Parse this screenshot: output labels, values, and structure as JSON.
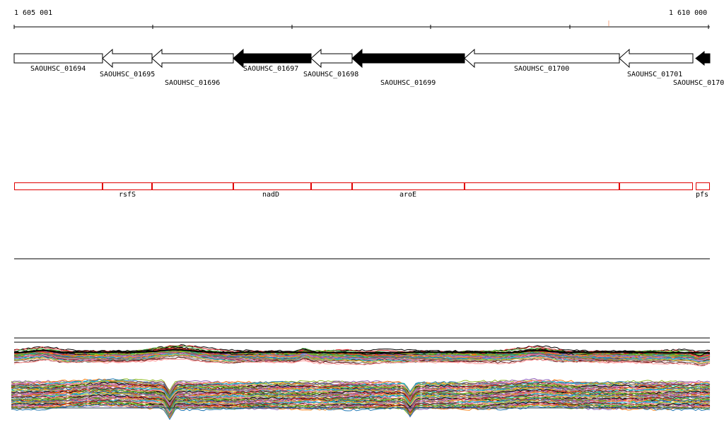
{
  "coordinates": {
    "start_label": "1 605 001",
    "end_label": "1 610 000"
  },
  "genes": [
    {
      "locus": "SAOUHSC_01694",
      "strand": "+",
      "filled": false
    },
    {
      "locus": "SAOUHSC_01695",
      "strand": "-",
      "filled": false
    },
    {
      "locus": "SAOUHSC_01696",
      "strand": "-",
      "filled": false
    },
    {
      "locus": "SAOUHSC_01697",
      "strand": "-",
      "filled": true
    },
    {
      "locus": "SAOUHSC_01698",
      "strand": "-",
      "filled": false
    },
    {
      "locus": "SAOUHSC_01699",
      "strand": "-",
      "filled": true
    },
    {
      "locus": "SAOUHSC_01700",
      "strand": "-",
      "filled": false
    },
    {
      "locus": "SAOUHSC_01701",
      "strand": "-",
      "filled": false
    },
    {
      "locus": "SAOUHSC_0170",
      "strand": "-",
      "filled": true
    }
  ],
  "gene_names": [
    "",
    "rsfS",
    "",
    "nadD",
    "",
    "aroE",
    "",
    "",
    "pfs"
  ],
  "colors": {
    "axis": "#000000",
    "gene_outline": "#000000",
    "gene_name_box": "#e00000",
    "tick_marker": "#f4a582",
    "track_palette": [
      "#000000",
      "#d62728",
      "#2ca02c",
      "#8fbc1f",
      "#9467bd",
      "#ff7f0e",
      "#1f77b4",
      "#8c564b",
      "#e377c2",
      "#17becf",
      "#bcbd22",
      "#7f7f7f",
      "#6b1a1a",
      "#ff9999"
    ]
  }
}
